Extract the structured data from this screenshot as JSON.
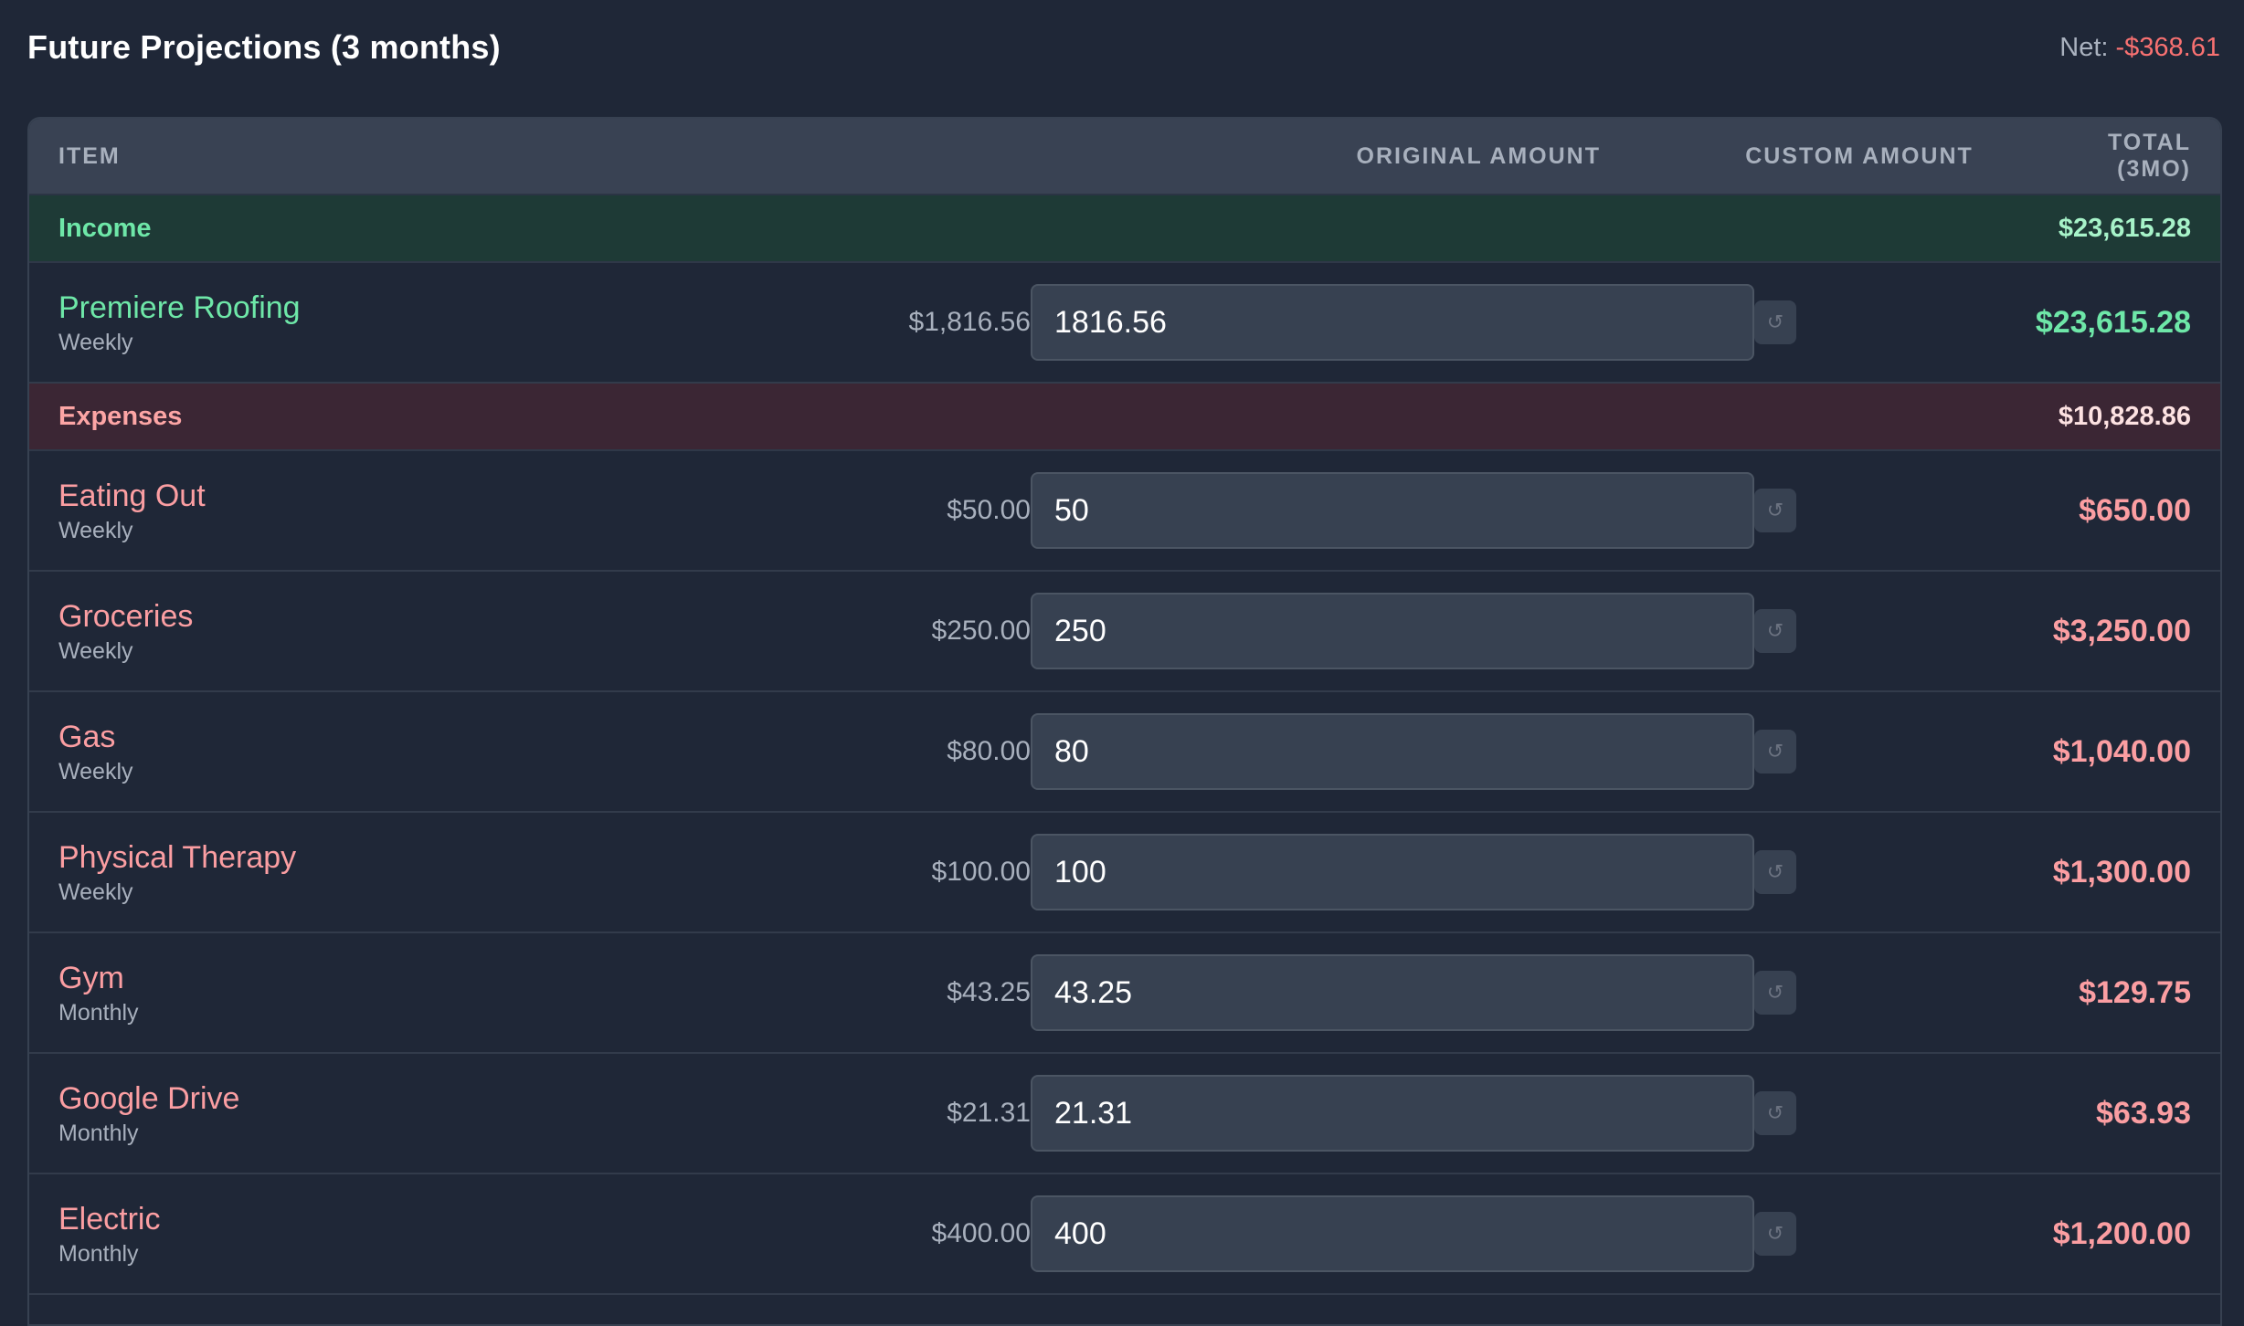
{
  "header": {
    "title": "Future Projections (3 months)",
    "net_label": "Net:",
    "net_value": "-$368.61"
  },
  "table": {
    "columns": {
      "item": "ITEM",
      "original": "ORIGINAL AMOUNT",
      "custom": "CUSTOM AMOUNT",
      "total": "TOTAL (3MO)"
    },
    "income": {
      "label": "Income",
      "total": "$23,615.28",
      "rows": [
        {
          "name": "Premiere Roofing",
          "freq": "Weekly",
          "original": "$1,816.56",
          "custom": "1816.56",
          "total": "$23,615.28"
        }
      ]
    },
    "expenses": {
      "label": "Expenses",
      "total": "$10,828.86",
      "rows": [
        {
          "name": "Eating Out",
          "freq": "Weekly",
          "original": "$50.00",
          "custom": "50",
          "total": "$650.00"
        },
        {
          "name": "Groceries",
          "freq": "Weekly",
          "original": "$250.00",
          "custom": "250",
          "total": "$3,250.00"
        },
        {
          "name": "Gas",
          "freq": "Weekly",
          "original": "$80.00",
          "custom": "80",
          "total": "$1,040.00"
        },
        {
          "name": "Physical Therapy",
          "freq": "Weekly",
          "original": "$100.00",
          "custom": "100",
          "total": "$1,300.00"
        },
        {
          "name": "Gym",
          "freq": "Monthly",
          "original": "$43.25",
          "custom": "43.25",
          "total": "$129.75"
        },
        {
          "name": "Google Drive",
          "freq": "Monthly",
          "original": "$21.31",
          "custom": "21.31",
          "total": "$63.93"
        },
        {
          "name": "Electric",
          "freq": "Monthly",
          "original": "$400.00",
          "custom": "400",
          "total": "$1,200.00"
        }
      ]
    }
  },
  "icons": {
    "reset": "reset-icon",
    "reset_glyph": "↺"
  },
  "colors": {
    "background": "#1f2737",
    "income": "#6ee7a8",
    "expense": "#fb9ea2",
    "net_negative": "#f87171"
  }
}
